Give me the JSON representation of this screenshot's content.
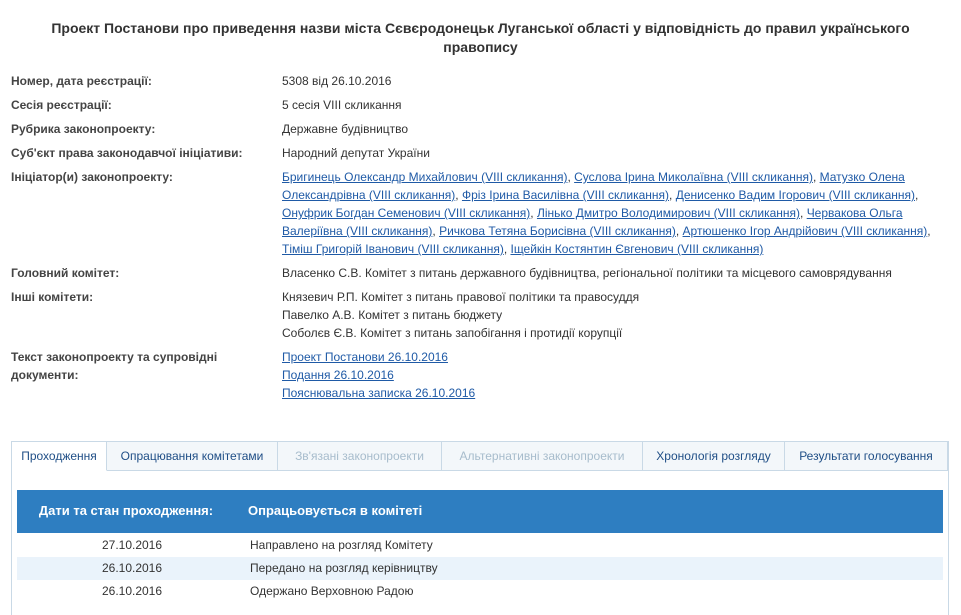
{
  "title": "Проект Постанови про приведення назви міста Сєвєродонецьк Луганської області у відповідність до правил українського правопису",
  "fields": {
    "number_label": "Номер, дата реєстрації:",
    "number_value": "5308 від 26.10.2016",
    "session_label": "Сесія реєстрації:",
    "session_value": "5 сесія VIII скликання",
    "rubric_label": "Рубрика законопроекту:",
    "rubric_value": "Державне будівництво",
    "subject_label": "Суб'єкт права законодавчої ініціативи:",
    "subject_value": "Народний депутат України",
    "initiators_label": "Ініціатор(и) законопроекту:",
    "initiators_lines": [
      [
        {
          "text": "Бригинець Олександр Михайлович (VIII скликання)",
          "sep": ", "
        },
        {
          "text": "Суслова Ірина Миколаївна (VIII скликання)",
          "sep": ", "
        },
        {
          "text": "Матузко Олена",
          "sep": ""
        }
      ],
      [
        {
          "text": "Олександрівна (VIII скликання)",
          "sep": ", "
        },
        {
          "text": "Фріз Ірина Василівна (VIII скликання)",
          "sep": ", "
        },
        {
          "text": "Денисенко Вадим Ігорович (VIII скликання)",
          "sep": ","
        }
      ],
      [
        {
          "text": "Онуфрик Богдан Семенович (VIII скликання)",
          "sep": ", "
        },
        {
          "text": "Лінько Дмитро Володимирович (VIII скликання)",
          "sep": ", "
        },
        {
          "text": "Червакова Ольга",
          "sep": ""
        }
      ],
      [
        {
          "text": "Валеріївна (VIII скликання)",
          "sep": ", "
        },
        {
          "text": "Ричкова Тетяна Борисівна (VIII скликання)",
          "sep": ", "
        },
        {
          "text": "Артюшенко Ігор Андрійович (VIII скликання)",
          "sep": ","
        }
      ],
      [
        {
          "text": "Тіміш Григорій Іванович (VIII скликання)",
          "sep": ", "
        },
        {
          "text": "Іщейкін Костянтин Євгенович (VIII скликання)",
          "sep": ""
        }
      ]
    ],
    "main_committee_label": "Головний комітет:",
    "main_committee_value": "Власенко С.В. Комітет з питань державного будівництва, регіональної політики та місцевого самоврядування",
    "other_committees_label": "Інші комітети:",
    "other_committees": [
      "Князевич Р.П. Комітет з питань правової політики та правосуддя",
      "Павелко А.В. Комітет з питань бюджету",
      "Соболєв Є.В. Комітет з питань запобігання і протидії корупції"
    ],
    "docs_label": "Текст законопроекту та супровідні документи:",
    "docs": [
      "Проект Постанови 26.10.2016",
      "Подання 26.10.2016",
      "Пояснювальна записка 26.10.2016"
    ]
  },
  "tabs": [
    {
      "label": "Проходження",
      "state": "active"
    },
    {
      "label": "Опрацювання комітетами",
      "state": "normal"
    },
    {
      "label": "Зв'язані законопроекти",
      "state": "disabled"
    },
    {
      "label": "Альтернативні законопроекти",
      "state": "disabled"
    },
    {
      "label": "Хронологія розгляду",
      "state": "normal"
    },
    {
      "label": "Результати голосування",
      "state": "normal"
    }
  ],
  "status": {
    "header_dates": "Дати та стан проходження:",
    "header_state": "Опрацьовується в комітеті",
    "rows": [
      {
        "date": "27.10.2016",
        "text": "Направлено на розгляд Комітету"
      },
      {
        "date": "26.10.2016",
        "text": "Передано на розгляд керівництву"
      },
      {
        "date": "26.10.2016",
        "text": "Одержано Верховною Радою"
      }
    ]
  },
  "colors": {
    "link": "#1f5aa6",
    "header_bg": "#2e7ec1",
    "alt_row": "#eaf3fb",
    "tab_border": "#c9d9e6"
  }
}
